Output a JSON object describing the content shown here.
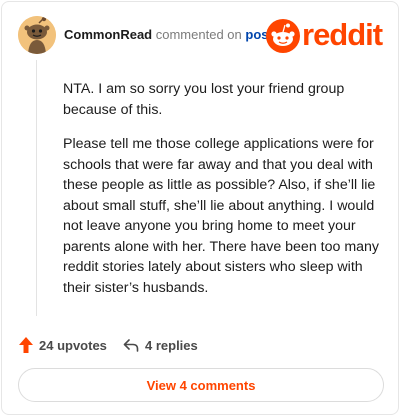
{
  "comment": {
    "username": "CommonRead",
    "action_text": "commented on",
    "post_link": "post",
    "paragraphs": [
      "NTA. I am so sorry you lost your friend group because of this.",
      "Please tell me those college applications were for schools that were far away and that you deal with these people as little as possible? Also, if she’ll lie about small stuff, she’ll lie about anything. I would not leave anyone you bring home to meet your parents alone with her. There have been too many reddit stories lately about sisters who sleep with their sister’s husbands."
    ],
    "upvotes": "24 upvotes",
    "replies": "4 replies",
    "view_button": "View 4 comments"
  },
  "brand": {
    "wordmark": "reddit",
    "color": "#ff4500"
  },
  "icons": {
    "avatar": "snoo-avatar",
    "logo": "reddit-snoo-icon",
    "upvote": "upvote-arrow-icon",
    "reply": "reply-arrow-icon"
  }
}
